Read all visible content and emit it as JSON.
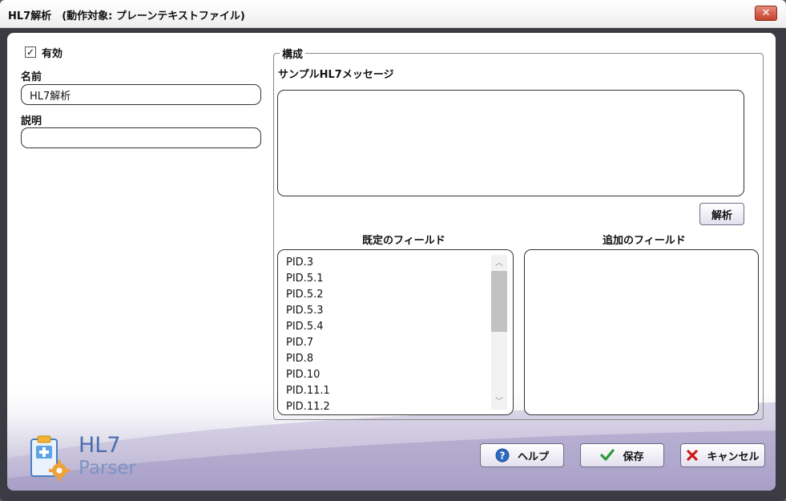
{
  "window": {
    "title": "HL7解析　(動作対象: プレーンテキストファイル)",
    "close_glyph": "✕"
  },
  "left": {
    "enabled_checked": true,
    "enabled_label": "有効",
    "name_label": "名前",
    "name_value": "HL7解析",
    "description_label": "説明",
    "description_value": ""
  },
  "config": {
    "group_label": "構成",
    "sample_label": "サンプルHL7メッセージ",
    "sample_value": "",
    "parse_button": "解析",
    "default_fields_label": "既定のフィールド",
    "additional_fields_label": "追加のフィールド",
    "default_fields": [
      "PID.3",
      "PID.5.1",
      "PID.5.2",
      "PID.5.3",
      "PID.5.4",
      "PID.7",
      "PID.8",
      "PID.10",
      "PID.11.1",
      "PID.11.2"
    ],
    "additional_fields": []
  },
  "footer": {
    "logo_line1": "HL7",
    "logo_line2": "Parser",
    "help_button": "ヘルプ",
    "save_button": "保存",
    "cancel_button": "キャンセル"
  },
  "colors": {
    "accent": "#8f86b8",
    "help_icon": "#2f6bc2",
    "save_icon": "#2e9a3a",
    "cancel_icon": "#cc1c1c",
    "close_button": "#c4412a"
  }
}
